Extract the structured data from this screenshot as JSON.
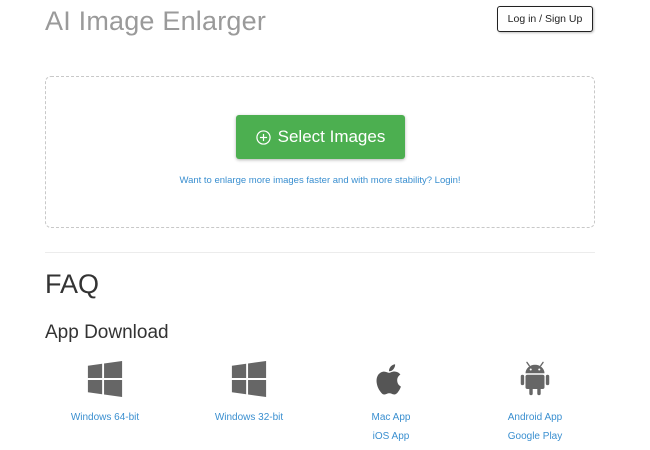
{
  "header": {
    "title": "AI Image Enlarger",
    "login_label": "Log in / Sign Up"
  },
  "upload": {
    "select_label": "Select Images",
    "hint": "Want to enlarge more images faster and with more stability? Login!",
    "button_color": "#4caf50"
  },
  "faq": {
    "heading": "FAQ"
  },
  "app_download": {
    "heading": "App Download",
    "items": [
      {
        "icon": "windows-icon",
        "links": [
          "Windows 64-bit"
        ]
      },
      {
        "icon": "windows-icon",
        "links": [
          "Windows 32-bit"
        ]
      },
      {
        "icon": "apple-icon",
        "links": [
          "Mac App",
          "iOS App"
        ]
      },
      {
        "icon": "android-icon",
        "links": [
          "Android App",
          "Google Play"
        ]
      }
    ]
  },
  "link_color": "#3a8fd0"
}
